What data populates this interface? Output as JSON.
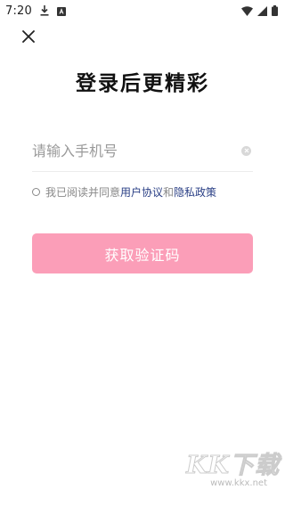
{
  "status_bar": {
    "time": "7:20",
    "icons": [
      "download-icon",
      "notification-icon",
      "wifi-icon",
      "signal-icon",
      "battery-icon"
    ]
  },
  "close": {
    "icon": "close-icon"
  },
  "title": "登录后更精彩",
  "phone": {
    "value": "",
    "placeholder": "请输入手机号"
  },
  "agreement": {
    "prefix": "我已阅读并同意",
    "user_agreement": "用户协议",
    "connector": "和",
    "privacy_policy": "隐私政策",
    "checked": false
  },
  "get_code_button": {
    "label": "获取验证码"
  },
  "watermark": {
    "text": "KK下载",
    "url": "www.kkx.net"
  },
  "colors": {
    "button": "#fb9eb8",
    "link": "#2a3f85",
    "placeholder": "#9a9a9a"
  }
}
